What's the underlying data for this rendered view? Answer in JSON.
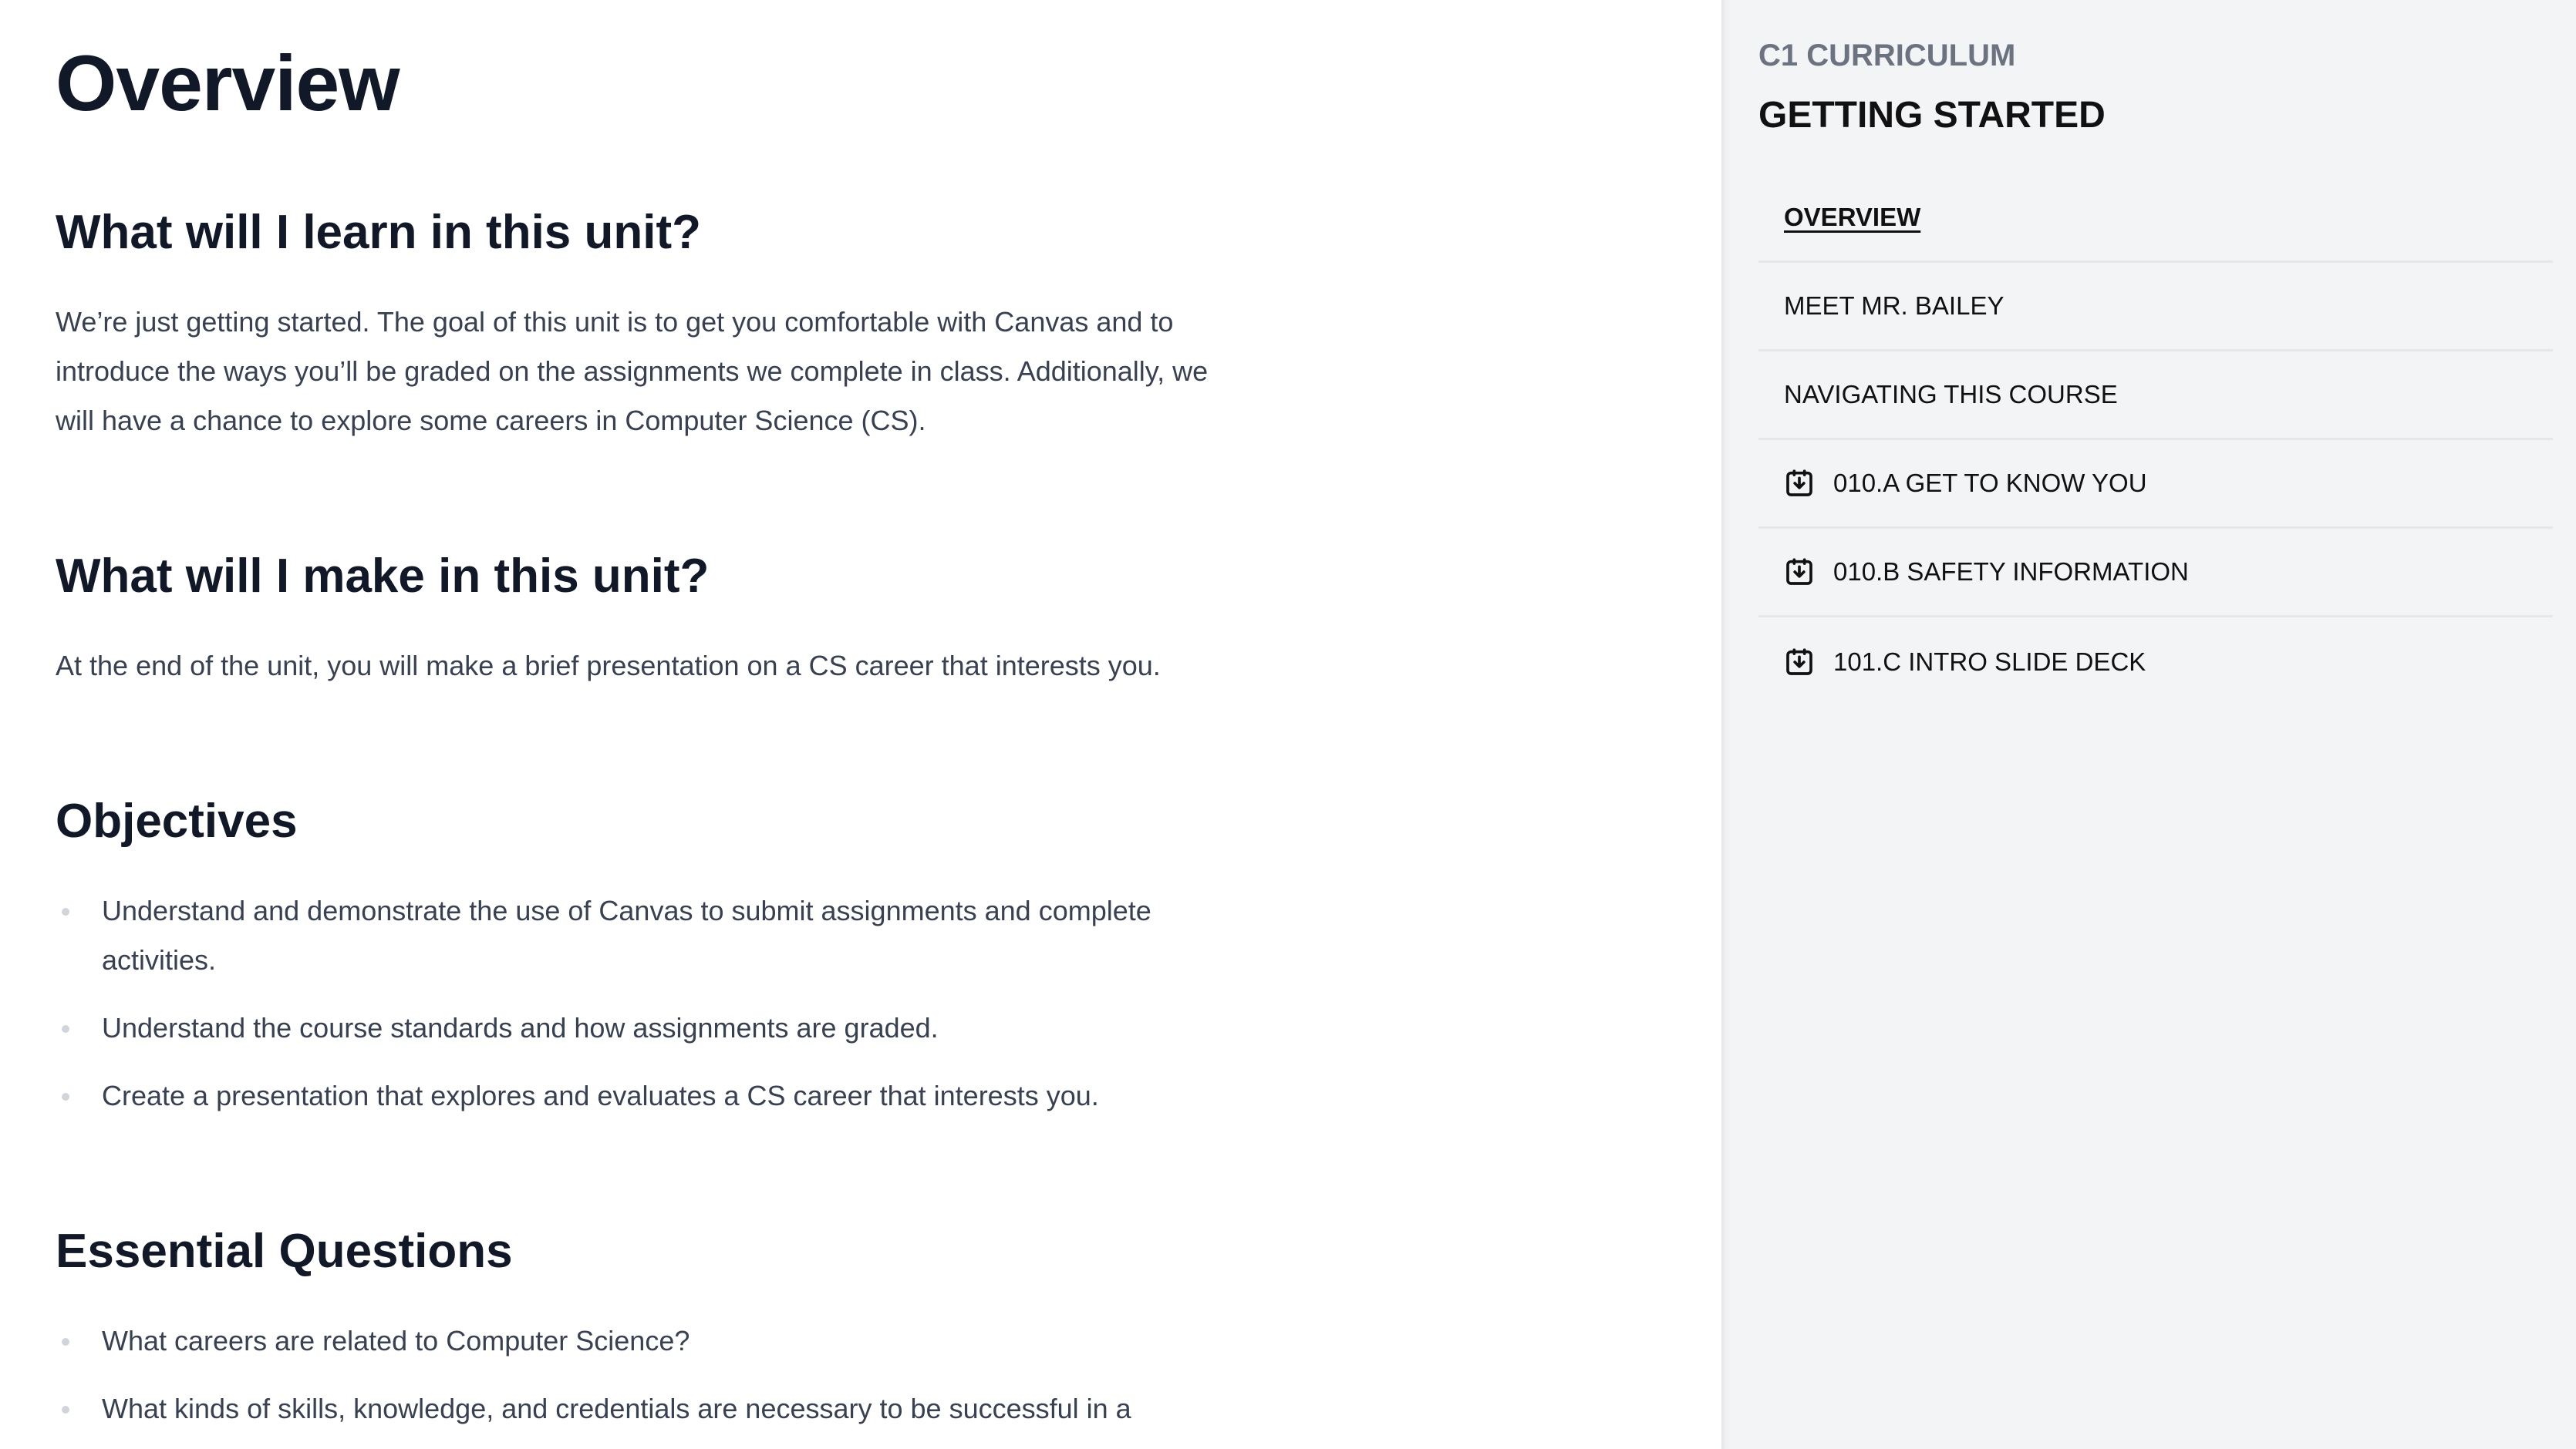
{
  "main": {
    "title": "Overview",
    "sections": [
      {
        "heading": "What will I learn in this unit?",
        "paragraph": "We’re just getting started. The goal of this unit is to get you comfortable with Canvas and to introduce the ways you’ll be graded on the assignments we complete in class. Additionally, we will have a chance to explore some careers in Computer Science (CS)."
      },
      {
        "heading": "What will I make in this unit?",
        "paragraph": "At the end of the unit, you will make a brief presentation on a CS career that interests you."
      },
      {
        "heading": "Objectives",
        "items": [
          "Understand and demonstrate the use of Canvas to submit assignments and complete activities.",
          "Understand the course standards and how assignments are graded.",
          "Create a presentation that explores and evaluates a CS career that interests you."
        ]
      },
      {
        "heading": "Essential Questions",
        "items": [
          "What careers are related to Computer Science?",
          "What kinds of skills, knowledge, and credentials are necessary to be successful in a"
        ]
      }
    ]
  },
  "sidebar": {
    "eyebrow": "C1 CURRICULUM",
    "title": "GETTING STARTED",
    "items": [
      {
        "label": "OVERVIEW",
        "active": true,
        "icon": ""
      },
      {
        "label": "MEET MR. BAILEY",
        "active": false,
        "icon": ""
      },
      {
        "label": "NAVIGATING THIS COURSE",
        "active": false,
        "icon": ""
      },
      {
        "label": "010.A GET TO KNOW YOU",
        "active": false,
        "icon": "assignment-icon"
      },
      {
        "label": "010.B SAFETY INFORMATION",
        "active": false,
        "icon": "assignment-icon"
      },
      {
        "label": "101.C INTRO SLIDE DECK",
        "active": false,
        "icon": "assignment-icon"
      }
    ]
  },
  "colors": {
    "heading": "#111827",
    "body_text": "#374151",
    "sidebar_bg": "#f3f4f6",
    "eyebrow": "#6b7280"
  }
}
